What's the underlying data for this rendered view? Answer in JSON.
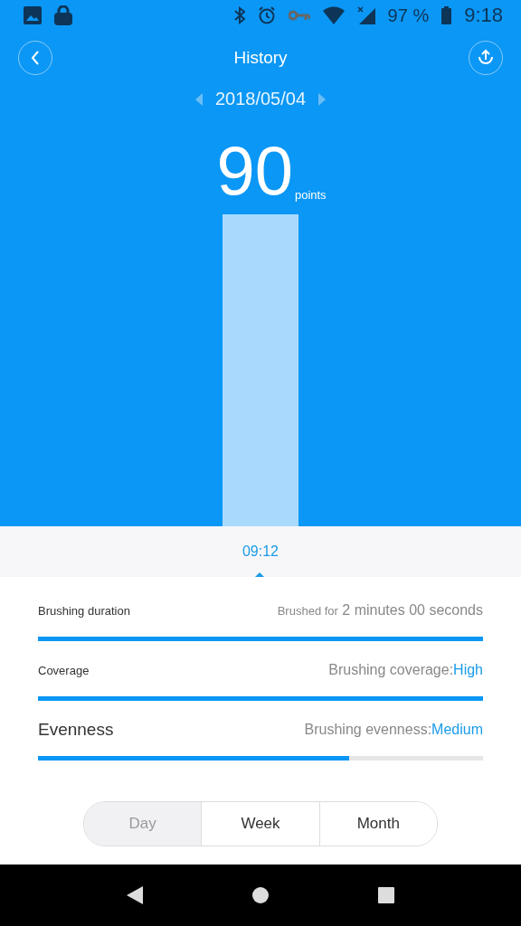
{
  "status_bar": {
    "battery": "97 %",
    "time": "9:18"
  },
  "header": {
    "title": "History"
  },
  "date": "2018/05/04",
  "score": {
    "value": "90",
    "unit": "points"
  },
  "session": {
    "time": "09:12"
  },
  "metrics": [
    {
      "kind": "duration",
      "label": "Brushing duration",
      "label_large": false,
      "prefix": "Brushed for",
      "value": "2 minutes 00 seconds",
      "level": 1
    },
    {
      "kind": "rating",
      "label": "Coverage",
      "label_large": false,
      "prefix": "Brushing coverage:",
      "value": "High",
      "level": 1
    },
    {
      "kind": "rating",
      "label": "Evenness",
      "label_large": true,
      "prefix": "Brushing evenness:",
      "value": "Medium",
      "level": 0.7
    }
  ],
  "periods": [
    {
      "label": "Day",
      "selected": true
    },
    {
      "label": "Week",
      "selected": false
    },
    {
      "label": "Month",
      "selected": false
    }
  ]
}
